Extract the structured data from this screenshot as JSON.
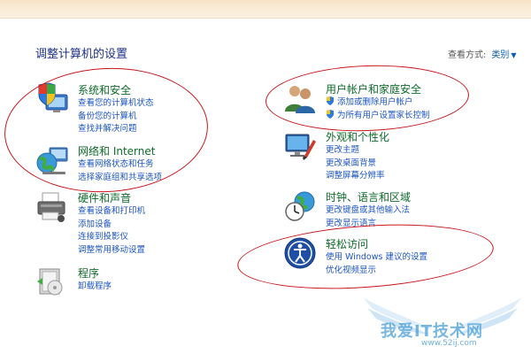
{
  "page": {
    "title": "调整计算机的设置",
    "view_by_label": "查看方式:",
    "view_by_value": "类别"
  },
  "categories": {
    "system_security": {
      "title": "系统和安全",
      "icon": "shield-computer-icon",
      "links": [
        "查看您的计算机状态",
        "备份您的计算机",
        "查找并解决问题"
      ]
    },
    "network": {
      "title": "网络和 Internet",
      "icon": "network-globe-icon",
      "links": [
        "查看网络状态和任务",
        "选择家庭组和共享选项"
      ]
    },
    "hardware": {
      "title": "硬件和声音",
      "icon": "printer-icon",
      "links": [
        "查看设备和打印机",
        "添加设备",
        "连接到投影仪",
        "调整常用移动设置"
      ]
    },
    "programs": {
      "title": "程序",
      "icon": "programs-disc-icon",
      "links": [
        "卸载程序"
      ]
    },
    "user_accounts": {
      "title": "用户帐户和家庭安全",
      "icon": "users-icon",
      "links": [
        "添加或删除用户帐户",
        "为所有用户设置家长控制"
      ]
    },
    "appearance": {
      "title": "外观和个性化",
      "icon": "monitor-paint-icon",
      "links": [
        "更改主题",
        "更改桌面背景",
        "调整屏幕分辨率"
      ]
    },
    "clock_region": {
      "title": "时钟、语言和区域",
      "icon": "clock-globe-icon",
      "links": [
        "更改键盘或其他输入法",
        "更改显示语言"
      ]
    },
    "ease_access": {
      "title": "轻松访问",
      "icon": "ease-of-access-icon",
      "links": [
        "使用 Windows 建议的设置",
        "优化视频显示"
      ]
    }
  },
  "watermark": {
    "site_name": "我爱IT技术网",
    "url": "www.52ij.com"
  },
  "colors": {
    "title_blue": "#1e3287",
    "category_green": "#0e6b2a",
    "link_blue": "#1c55c0",
    "annotation_red": "#c8161d"
  }
}
